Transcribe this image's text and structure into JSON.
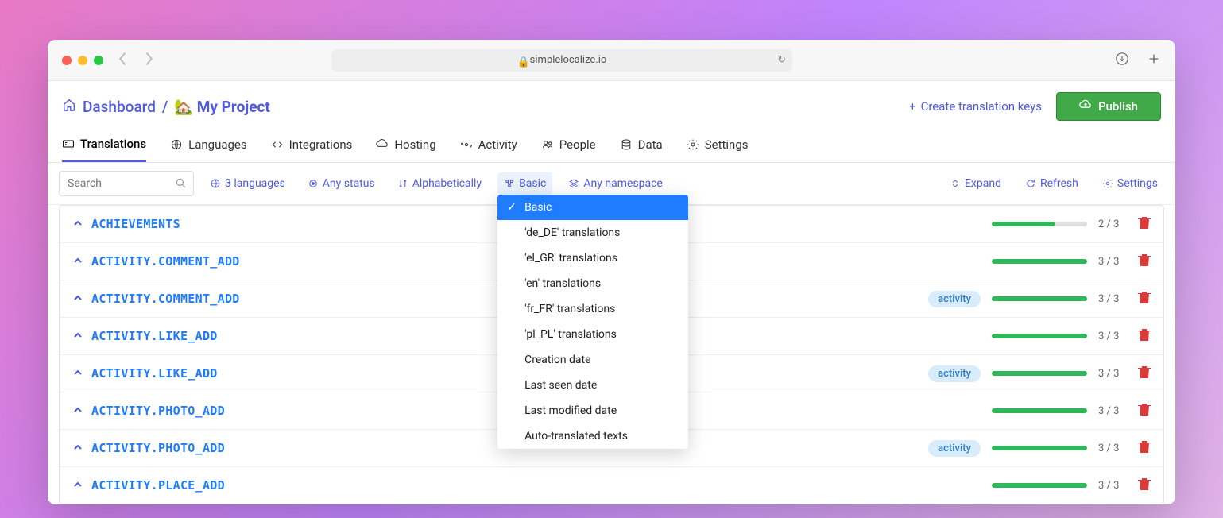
{
  "browser": {
    "url": "simplelocalize.io"
  },
  "breadcrumb": {
    "dashboard": "Dashboard",
    "separator": "/",
    "project": "🏡 My Project"
  },
  "header": {
    "create_keys": "Create translation keys",
    "publish": "Publish"
  },
  "tabs": {
    "translations": "Translations",
    "languages": "Languages",
    "integrations": "Integrations",
    "hosting": "Hosting",
    "activity": "Activity",
    "people": "People",
    "data": "Data",
    "settings": "Settings"
  },
  "filters": {
    "search_placeholder": "Search",
    "languages": "3 languages",
    "status": "Any status",
    "sort": "Alphabetically",
    "view": "Basic",
    "namespace": "Any namespace",
    "expand": "Expand",
    "refresh": "Refresh",
    "settings": "Settings"
  },
  "dropdown": {
    "items": [
      "Basic",
      "'de_DE' translations",
      "'el_GR' translations",
      "'en' translations",
      "'fr_FR' translations",
      "'pl_PL' translations",
      "Creation date",
      "Last seen date",
      "Last modified date",
      "Auto-translated texts"
    ]
  },
  "keys": [
    {
      "name": "ACHIEVEMENTS",
      "badge": "",
      "done": 2,
      "total": 3
    },
    {
      "name": "ACTIVITY.COMMENT_ADD",
      "badge": "",
      "done": 3,
      "total": 3
    },
    {
      "name": "ACTIVITY.COMMENT_ADD",
      "badge": "activity",
      "done": 3,
      "total": 3
    },
    {
      "name": "ACTIVITY.LIKE_ADD",
      "badge": "",
      "done": 3,
      "total": 3
    },
    {
      "name": "ACTIVITY.LIKE_ADD",
      "badge": "activity",
      "done": 3,
      "total": 3
    },
    {
      "name": "ACTIVITY.PHOTO_ADD",
      "badge": "",
      "done": 3,
      "total": 3
    },
    {
      "name": "ACTIVITY.PHOTO_ADD",
      "badge": "activity",
      "done": 3,
      "total": 3
    },
    {
      "name": "ACTIVITY.PLACE_ADD",
      "badge": "",
      "done": 3,
      "total": 3
    }
  ]
}
